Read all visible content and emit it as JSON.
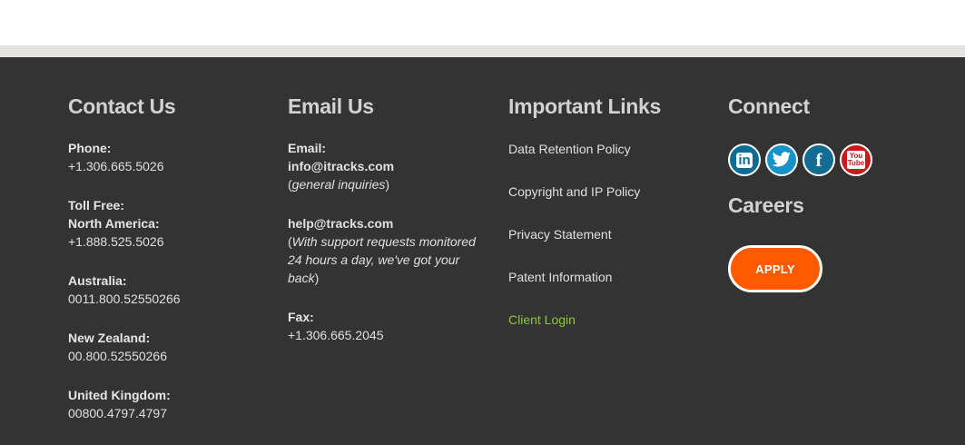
{
  "contact": {
    "heading": "Contact Us",
    "phone_label": "Phone:",
    "phone_value": "+1.306.665.5026",
    "tollfree_label": "Toll Free:",
    "na_label": "North America:",
    "na_value": "+1.888.525.5026",
    "au_label": "Australia:",
    "au_value": "0011.800.52550266",
    "nz_label": "New Zealand:",
    "nz_value": "00.800.52550266",
    "uk_label": "United Kingdom:",
    "uk_value": "00800.4797.4797"
  },
  "email": {
    "heading": "Email Us",
    "email_label": "Email:",
    "info_address": "info@itracks.com",
    "info_open": "(",
    "info_note": "general inquiries",
    "info_close": ")",
    "help_address": "help@tracks.com",
    "help_open": "(",
    "help_note": "With support requests monitored 24 hours a day, we've got your back",
    "help_close": ")",
    "fax_label": "Fax:",
    "fax_value": "+1.306.665.2045"
  },
  "links": {
    "heading": "Important Links",
    "items": [
      "Data Retention Policy",
      "Copyright and IP Policy",
      "Privacy Statement",
      "Patent Information",
      "Client Login"
    ]
  },
  "connect": {
    "heading": "Connect",
    "social": [
      {
        "icon": "linkedin-icon",
        "glyph": "in"
      },
      {
        "icon": "twitter-icon",
        "glyph": "t"
      },
      {
        "icon": "facebook-icon",
        "glyph": "f"
      },
      {
        "icon": "youtube-icon",
        "glyph": "You Tube"
      }
    ],
    "careers_heading": "Careers",
    "apply_label": "APPLY"
  },
  "colors": {
    "footer_bg": "#333333",
    "accent_orange": "#ff5a00",
    "link_green": "#8cc63f"
  }
}
